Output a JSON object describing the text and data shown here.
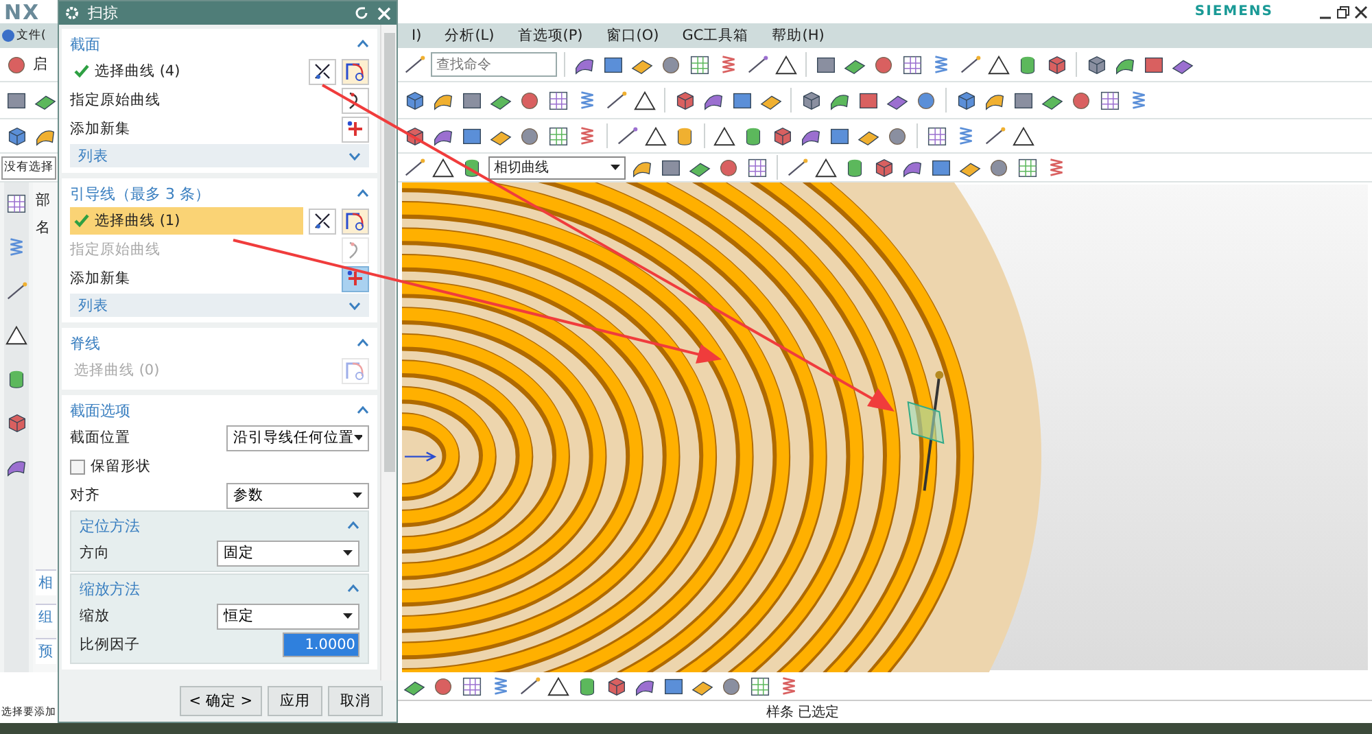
{
  "app": {
    "logo": "NX",
    "brand": "SIEMENS"
  },
  "menu": [
    {
      "label": "I)"
    },
    {
      "label": "分析(L)"
    },
    {
      "label": "首选项(P)"
    },
    {
      "label": "窗口(O)"
    },
    {
      "label": "GC工具箱"
    },
    {
      "label": "帮助(H)"
    }
  ],
  "behind_dialog": {
    "menu_fragment": "文件(",
    "start_fragment": "启",
    "selection_filter": "没有选择",
    "navigator_title": "部",
    "column_fragment": "名",
    "panel_tabs": [
      "相",
      "组",
      "预"
    ]
  },
  "toolbar": {
    "search": {
      "placeholder": "查找命令"
    },
    "curve_rule": "相切曲线"
  },
  "dialog": {
    "title": "扫掠",
    "sections": [
      {
        "title": "截面",
        "expanded": true,
        "rows": [
          {
            "kind": "selector",
            "label": "选择曲线 (4)",
            "done": true,
            "selected": false,
            "disabled": false
          },
          {
            "kind": "action",
            "label": "指定原始曲线",
            "disabled": false
          },
          {
            "kind": "newset",
            "label": "添加新集",
            "active": false
          },
          {
            "kind": "list",
            "label": "列表",
            "expanded": false
          }
        ]
      },
      {
        "title": "引导线（最多 3 条）",
        "expanded": true,
        "rows": [
          {
            "kind": "selector",
            "label": "选择曲线 (1)",
            "done": true,
            "selected": true,
            "disabled": false
          },
          {
            "kind": "action",
            "label": "指定原始曲线",
            "disabled": true
          },
          {
            "kind": "newset",
            "label": "添加新集",
            "active": true
          },
          {
            "kind": "list",
            "label": "列表",
            "expanded": false
          }
        ]
      },
      {
        "title": "脊线",
        "expanded": true,
        "rows": [
          {
            "kind": "selector",
            "label": "选择曲线 (0)",
            "done": false,
            "selected": false,
            "disabled": true
          }
        ]
      },
      {
        "title": "截面选项",
        "expanded": true,
        "rows": [
          {
            "kind": "dropdown",
            "label": "截面位置",
            "value": "沿引导线任何位置"
          },
          {
            "kind": "checkbox",
            "label": "保留形状",
            "checked": false
          },
          {
            "kind": "dropdown",
            "label": "对齐",
            "value": "参数"
          },
          {
            "kind": "group",
            "title": "定位方法",
            "expanded": true,
            "rows": [
              {
                "kind": "dropdown",
                "label": "方向",
                "value": "固定"
              }
            ]
          },
          {
            "kind": "group",
            "title": "缩放方法",
            "expanded": true,
            "rows": [
              {
                "kind": "dropdown",
                "label": "缩放",
                "value": "恒定"
              },
              {
                "kind": "number",
                "label": "比例因子",
                "value": "1.0000",
                "selected": true
              }
            ]
          }
        ]
      }
    ],
    "buttons": [
      "< 确定 >",
      "应用",
      "取消"
    ]
  },
  "status_bar": {
    "prompt": "选择要添加",
    "message": "样条 已选定"
  }
}
